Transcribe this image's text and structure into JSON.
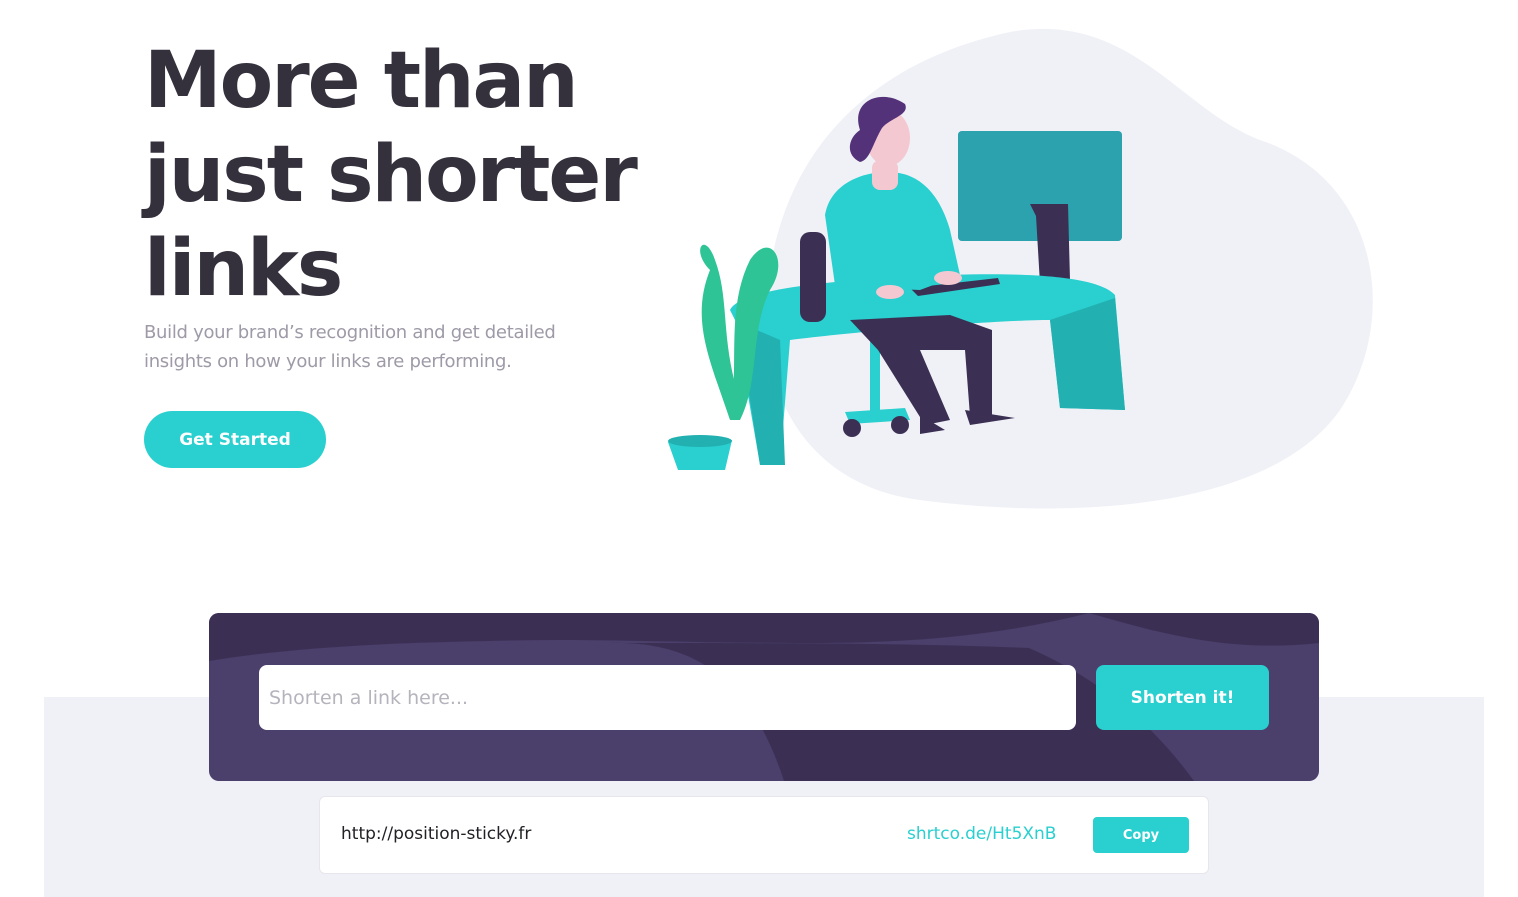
{
  "hero": {
    "title_lines": [
      "More than",
      "just shorter",
      "links"
    ],
    "subtitle": "Build your brand’s recognition and get detailed insights on how your links are performing.",
    "cta_label": "Get Started"
  },
  "shortener": {
    "placeholder": "Shorten a link here...",
    "value": "",
    "button_label": "Shorten it!"
  },
  "results": [
    {
      "original": "http://position-sticky.fr",
      "short": "shrtco.de/Ht5XnB",
      "copy_label": "Copy"
    }
  ],
  "colors": {
    "primary": "#2acfcf",
    "dark_violet": "#3b3054",
    "shorten_bg": "#4b3f6b",
    "heading": "#34313d",
    "gray_text": "#9e9aa7",
    "band": "#f0f1f6"
  }
}
